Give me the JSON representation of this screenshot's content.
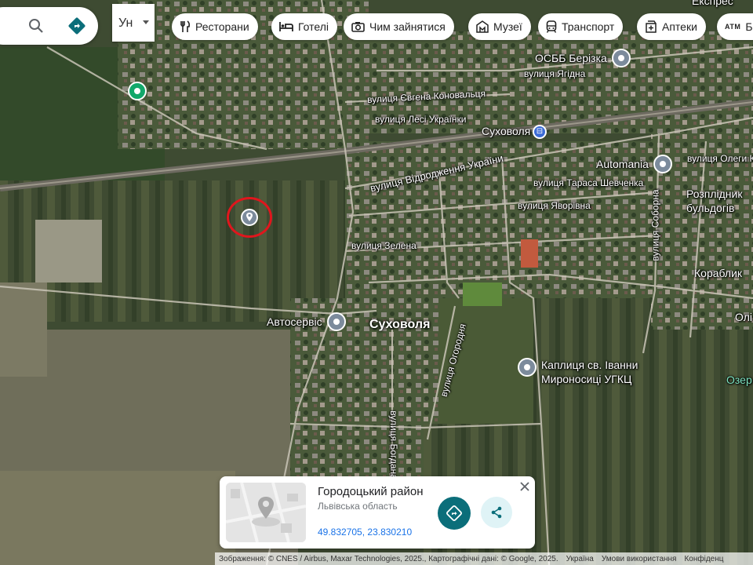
{
  "search": {
    "lang_label": "Ун"
  },
  "chips": [
    {
      "label": "Ресторани",
      "icon": "restaurant-icon"
    },
    {
      "label": "Готелі",
      "icon": "hotel-icon"
    },
    {
      "label": "Чим зайнятися",
      "icon": "camera-icon"
    },
    {
      "label": "Музеї",
      "icon": "museum-icon"
    },
    {
      "label": "Транспорт",
      "icon": "transit-icon"
    },
    {
      "label": "Аптеки",
      "icon": "pharmacy-icon"
    },
    {
      "label": "Ба",
      "icon": "atm-icon",
      "icon_text": "ATM"
    }
  ],
  "map": {
    "town": "Суховоля",
    "top_right_label": "Експрес",
    "streets": [
      "вулиця Ягідна",
      "вулиця Євгена Коновальця",
      "вулиця Лесі Українки",
      "вулиця Відродження України",
      "вулиця Тараса Шевченка",
      "вулиця Яворівна",
      "вулиця Зелена",
      "вулиця Соборна",
      "вулиця Огородня",
      "вулиця Богдана",
      "вулиця Олеги К"
    ],
    "station": "Суховоля",
    "pois": {
      "osbb": "ОСББ Берізка",
      "automania": "Automania",
      "rozplidnyk": [
        "Розплідник",
        "бульдогів"
      ],
      "korablyk": "Кораблик",
      "oli": "Олі",
      "avtoservis": "Автосервіс",
      "chapel": [
        "Каплиця св. Іванни",
        "Мироносиці УГКЦ"
      ],
      "ozer": "Озер"
    }
  },
  "card": {
    "title": "Городоцький район",
    "subtitle": "Львівська область",
    "coords": "49.832705, 23.830210"
  },
  "footer": {
    "imagery": "Зображення: © CNES / Airbus, Maxar Technologies, 2025., Картографічні дані: © Google, 2025.",
    "country": "Україна",
    "terms": "Умови використання",
    "privacy": "Конфіденц"
  },
  "colors": {
    "marker_circle": "#e0161d",
    "directions_button": "#0b6e7a",
    "share_button": "#dff3f6",
    "link": "#1a73e8"
  }
}
